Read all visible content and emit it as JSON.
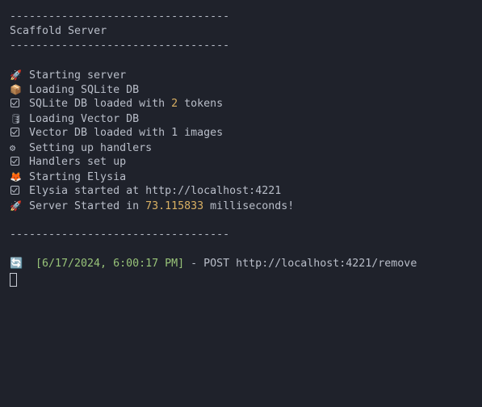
{
  "header": {
    "rule": "----------------------------------",
    "title": "Scaffold Server"
  },
  "log": {
    "l1_icon": "rocket-icon",
    "l1": "Starting server",
    "l2_icon": "package-icon",
    "l2": "Loading SQLite DB",
    "l3_pre": "SQLite DB loaded with ",
    "l3_num": "2",
    "l3_post": " tokens",
    "l4_icon": "database-icon",
    "l4": "Loading Vector DB",
    "l5": "Vector DB loaded with 1 images",
    "l6_icon": "gear-icon",
    "l6": "Setting up handlers",
    "l7": "Handlers set up",
    "l8_icon": "fox-icon",
    "l8": "Starting Elysia",
    "l9": "Elysia started at http://localhost:4221",
    "l10_pre": "Server Started in ",
    "l10_num": "73.115833",
    "l10_post": " milliseconds!"
  },
  "footer_rule": "----------------------------------",
  "request": {
    "icon": "refresh-icon",
    "timestamp": "[6/17/2024, 6:00:17 PM]",
    "rest": " - POST http://localhost:4221/remove"
  },
  "colors": {
    "background": "#1f222b",
    "text": "#b9bec9",
    "number": "#d9b063",
    "timestamp": "#98c379"
  }
}
